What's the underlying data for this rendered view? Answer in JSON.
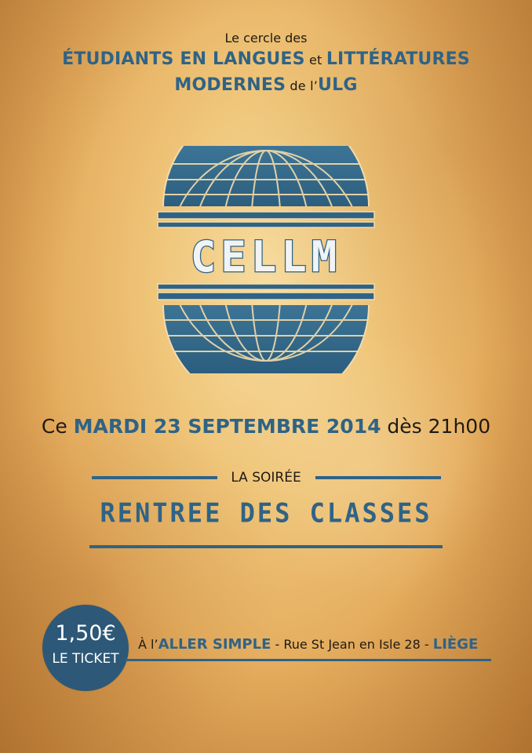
{
  "header": {
    "line1": "Le cercle des",
    "line2_strong_a": "ÉTUDIANTS EN LANGUES",
    "line2_small": " et ",
    "line2_strong_b": "LITTÉRATURES",
    "line3_strong_a": "MODERNES",
    "line3_small": " de l’",
    "line3_strong_b": "ULG"
  },
  "logo": {
    "text": "CELLM"
  },
  "date": {
    "prefix": "Ce ",
    "highlight": "MARDI 23 SEPTEMBRE 2014",
    "suffix": " dès 21h00"
  },
  "event": {
    "label": "LA SOIRÉE",
    "title": "RENTREE DES CLASSES"
  },
  "price": {
    "amount": "1,50€",
    "unit": "LE TICKET"
  },
  "venue": {
    "prefix": "À l’",
    "place": "ALLER SIMPLE",
    "address": " - Rue St Jean en Isle 28 - ",
    "city": "LIÈGE"
  },
  "colors": {
    "accent": "#2f6386",
    "badge": "#2d5877",
    "text": "#1f1a14",
    "paper": "#efc579"
  }
}
